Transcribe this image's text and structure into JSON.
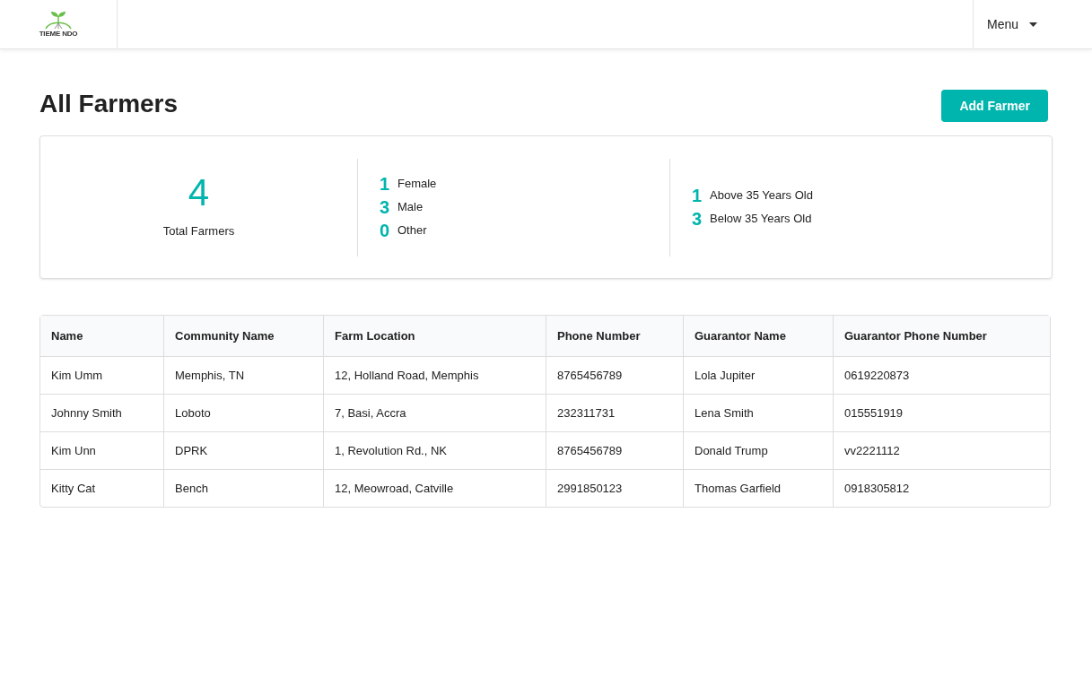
{
  "header": {
    "logo_text": "TIEME NDO",
    "menu": "Menu"
  },
  "page": {
    "title": "All Farmers",
    "add_button": "Add Farmer"
  },
  "summary": {
    "total": {
      "value": "4",
      "label": "Total Farmers"
    },
    "gender": [
      {
        "value": "1",
        "label": "Female"
      },
      {
        "value": "3",
        "label": "Male"
      },
      {
        "value": "0",
        "label": "Other"
      }
    ],
    "age": [
      {
        "value": "1",
        "label": "Above 35 Years Old"
      },
      {
        "value": "3",
        "label": "Below 35 Years Old"
      }
    ]
  },
  "table": {
    "columns": [
      "Name",
      "Community Name",
      "Farm Location",
      "Phone Number",
      "Guarantor Name",
      "Guarantor Phone Number"
    ],
    "rows": [
      [
        "Kim Umm",
        "Memphis, TN",
        "12, Holland Road, Memphis",
        "8765456789",
        "Lola Jupiter",
        "0619220873"
      ],
      [
        "Johnny Smith",
        "Loboto",
        "7, Basi, Accra",
        "232311731",
        "Lena Smith",
        "015551919"
      ],
      [
        "Kim Unn",
        "DPRK",
        "1, Revolution Rd., NK",
        "8765456789",
        "Donald Trump",
        "vv2221112"
      ],
      [
        "Kitty Cat",
        "Bench",
        "12, Meowroad, Catville",
        "2991850123",
        "Thomas Garfield",
        "0918305812"
      ]
    ]
  }
}
